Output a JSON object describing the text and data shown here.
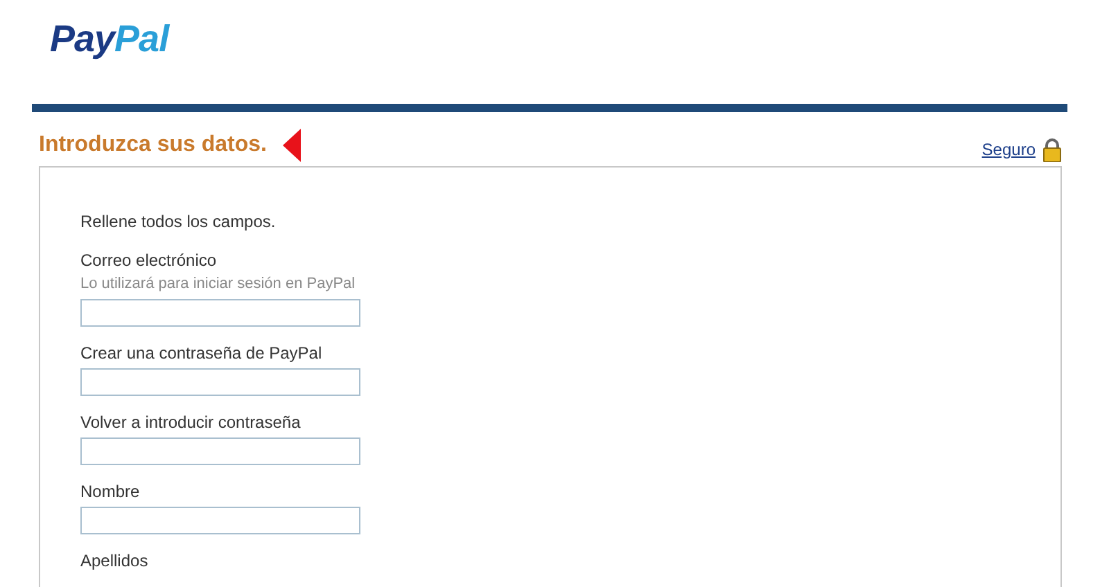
{
  "logo": {
    "parts": [
      "Pay",
      "Pal"
    ]
  },
  "heading": "Introduzca sus datos.",
  "secure_link": "Seguro",
  "instructions": "Rellene todos los campos.",
  "fields": [
    {
      "kind": "input",
      "label": "Correo electrónico",
      "hint": "Lo utilizará para iniciar sesión en PayPal"
    },
    {
      "kind": "input",
      "label": "Crear una contraseña de PayPal"
    },
    {
      "kind": "input",
      "label": "Volver a introducir contraseña"
    },
    {
      "kind": "input",
      "label": "Nombre"
    },
    {
      "kind": "label",
      "label": "Apellidos"
    }
  ]
}
